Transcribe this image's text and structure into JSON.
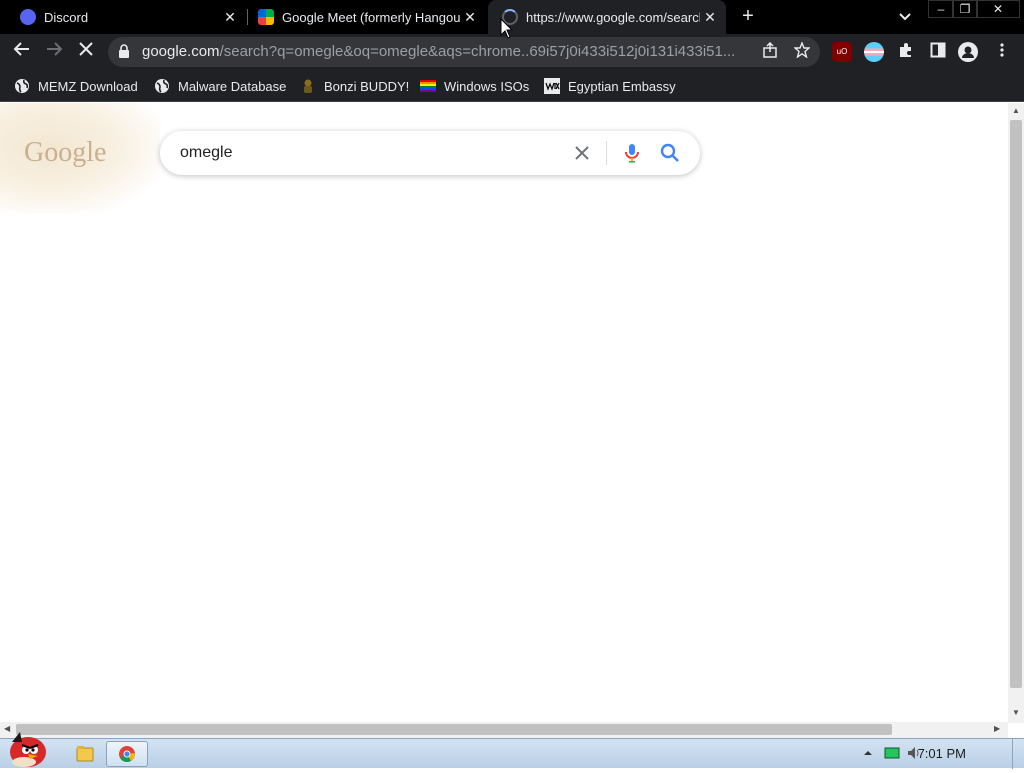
{
  "browser": {
    "tabs": [
      {
        "label": "Discord",
        "active": false,
        "icon": "discord-icon"
      },
      {
        "label": "Google Meet (formerly Hangouts)",
        "active": false,
        "icon": "google-meet-icon"
      },
      {
        "label": "https://www.google.com/search?q=omegle",
        "active": true,
        "icon": "loading-spinner-icon"
      }
    ],
    "tab_close_glyph": "✕",
    "new_tab_glyph": "+",
    "window_buttons": {
      "minimize": "–",
      "restore": "❐",
      "close": "✕"
    },
    "address": {
      "host": "google.com",
      "path": "/search?q=omegle&oq=omegle&aqs=chrome..69i57j0i433i512j0i131i433i51..."
    },
    "bookmarks": [
      {
        "label": "MEMZ Download",
        "icon": "globe-icon"
      },
      {
        "label": "Malware Database",
        "icon": "globe-icon"
      },
      {
        "label": "Bonzi BUDDY!",
        "icon": "bonzi-icon"
      },
      {
        "label": "Windows ISOs",
        "icon": "rainbow-flag-icon"
      },
      {
        "label": "Egyptian Embassy",
        "icon": "wix-icon"
      }
    ],
    "extensions": [
      "ublock-origin-icon",
      "flag-extension-icon",
      "puzzle-piece-icon",
      "side-panel-icon",
      "profile-icon",
      "menu-dots-icon"
    ]
  },
  "page": {
    "logo_text": "Google",
    "search": {
      "value": "omegle"
    }
  },
  "taskbar": {
    "time": "7:01 PM"
  },
  "colors": {
    "tab_strip": "#000000",
    "toolbar": "#202124",
    "omnibox": "#35363a",
    "search_blue": "#4285f4",
    "taskbar": "#c6d9ee"
  }
}
